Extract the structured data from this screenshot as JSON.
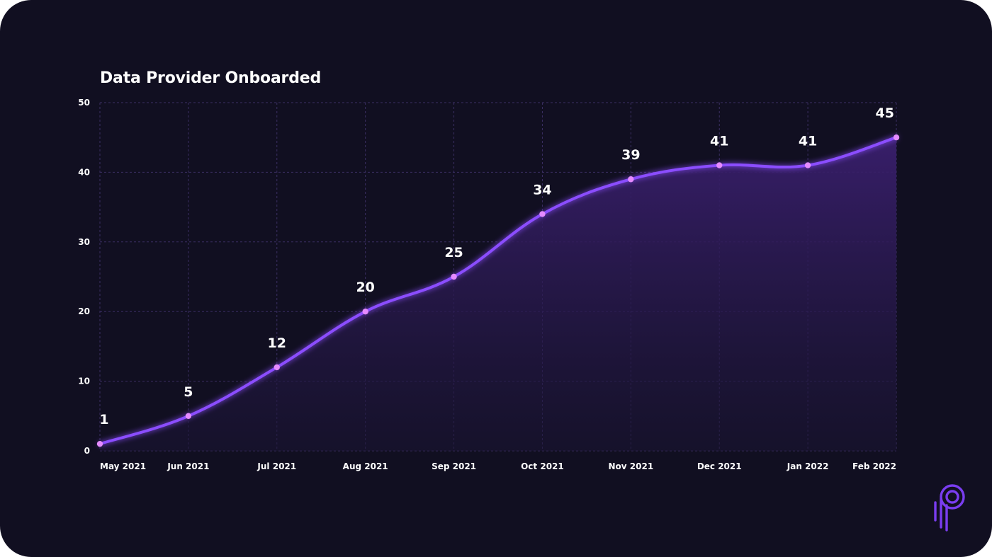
{
  "chart_data": {
    "type": "area",
    "title": "Data Provider Onboarded",
    "xlabel": "",
    "ylabel": "",
    "categories": [
      "May 2021",
      "Jun 2021",
      "Jul 2021",
      "Aug 2021",
      "Sep 2021",
      "Oct 2021",
      "Nov 2021",
      "Dec 2021",
      "Jan 2022",
      "Feb 2022"
    ],
    "values": [
      1,
      5,
      12,
      20,
      25,
      34,
      39,
      41,
      41,
      45
    ],
    "data_labels": [
      "1",
      "5",
      "12",
      "20",
      "25",
      "34",
      "39",
      "41",
      "41",
      "45"
    ],
    "ylim": [
      0,
      50
    ],
    "yticks": [
      "0",
      "10",
      "20",
      "30",
      "40",
      "50"
    ],
    "grid": true,
    "legend": "none",
    "colors": {
      "background": "#110f21",
      "line": "#8b4dff",
      "marker": "#e58bff",
      "fill": "#3a1f6e",
      "grid": "#3b2f63",
      "text": "#ffffff"
    }
  },
  "logo": {
    "icon": "p-logo-icon",
    "color": "#7a3df0"
  }
}
